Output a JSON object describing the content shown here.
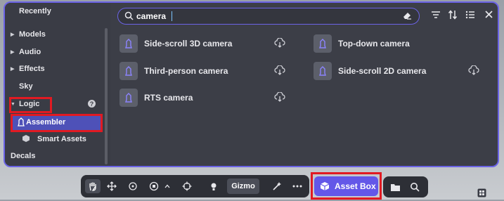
{
  "sidebar": {
    "items": [
      {
        "label": "Recently",
        "arrow": ""
      },
      {
        "label": "Models",
        "arrow": "▶"
      },
      {
        "label": "Audio",
        "arrow": "▶"
      },
      {
        "label": "Effects",
        "arrow": "▶"
      },
      {
        "label": "Sky",
        "arrow": ""
      },
      {
        "label": "Logic",
        "arrow": "▼"
      }
    ],
    "help_glyph": "?",
    "selected_label": "Assembler",
    "after_items": [
      {
        "label": "Smart Assets"
      },
      {
        "label": "Decals"
      }
    ]
  },
  "search": {
    "value": "camera"
  },
  "results": [
    {
      "label": "Side-scroll 3D camera"
    },
    {
      "label": "Top-down camera"
    },
    {
      "label": "Third-person camera"
    },
    {
      "label": "Side-scroll 2D camera"
    },
    {
      "label": "RTS camera"
    }
  ],
  "toolbar": {
    "gizmo_label": "Gizmo",
    "asset_box_label": "Asset Box"
  },
  "colors": {
    "accent": "#6b63e6",
    "asset_box": "#6357e8",
    "highlight": "#e11a22",
    "panel": "#3c3e47"
  }
}
